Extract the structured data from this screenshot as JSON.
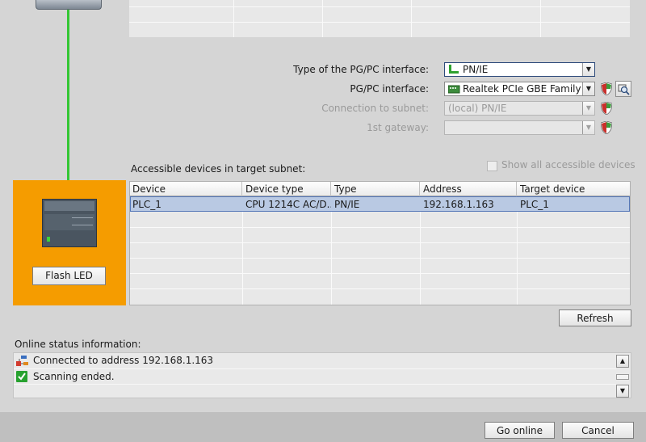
{
  "interface": {
    "type_label": "Type of the PG/PC interface:",
    "type_value": "PN/IE",
    "pgpc_label": "PG/PC interface:",
    "pgpc_value": "Realtek PCIe GBE Family C...",
    "subnet_label": "Connection to subnet:",
    "subnet_value": "(local) PN/IE",
    "gateway_label": "1st gateway:",
    "gateway_value": ""
  },
  "devices": {
    "section_title": "Accessible devices in target subnet:",
    "show_all_label": "Show all accessible devices",
    "show_all_checked": false,
    "columns": [
      "Device",
      "Device type",
      "Type",
      "Address",
      "Target device"
    ],
    "rows": [
      [
        "PLC_1",
        "CPU 1214C AC/D...",
        "PN/IE",
        "192.168.1.163",
        "PLC_1"
      ]
    ]
  },
  "flash_led_label": "Flash LED",
  "refresh_label": "Refresh",
  "online_status": {
    "title": "Online status information:",
    "messages": [
      {
        "text": "Connected to address 192.168.1.163",
        "icon": "network-connection-icon"
      },
      {
        "text": "Scanning ended.",
        "icon": "green-check-icon"
      }
    ]
  },
  "footer": {
    "go_online_label": "Go online",
    "cancel_label": "Cancel"
  },
  "colors": {
    "panel_bg": "#d5d5d5",
    "highlight": "#f59c00",
    "connection_line": "#34c734",
    "selected_row": "#b9c9e3"
  }
}
